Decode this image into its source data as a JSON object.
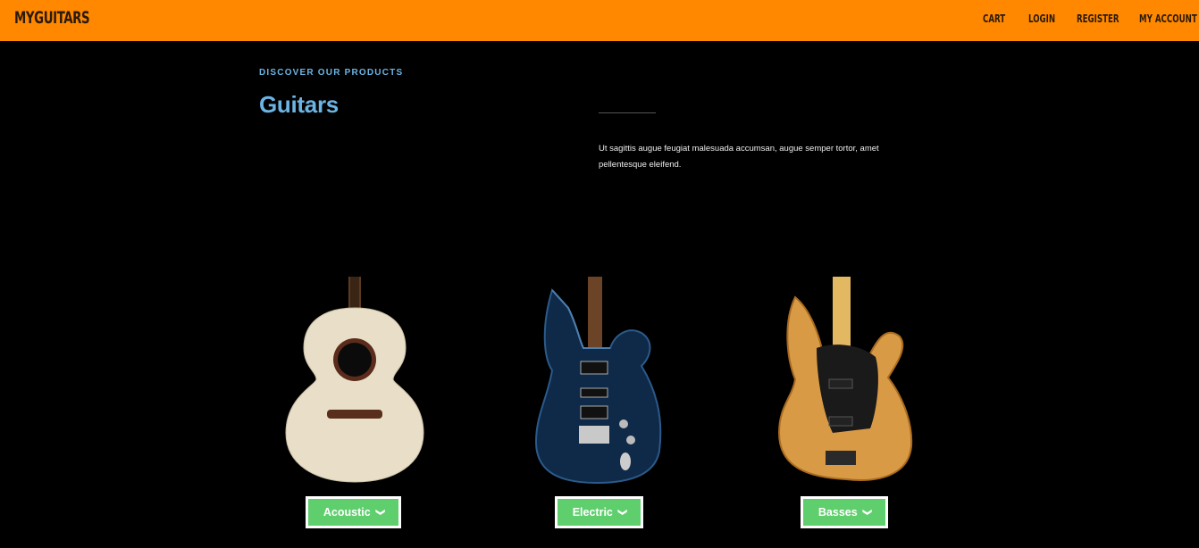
{
  "header": {
    "brand": "MYGUITARS",
    "nav": [
      "CART",
      "LOGIN",
      "REGISTER",
      "MY ACCOUNT"
    ]
  },
  "hero": {
    "eyebrow": "DISCOVER OUR PRODUCTS",
    "title": "Guitars",
    "description": "Ut sagittis augue feugiat malesuada accumsan, augue semper tortor, amet pellentesque eleifend."
  },
  "categories": [
    {
      "label": "Acoustic",
      "icon": "chevron-down-icon"
    },
    {
      "label": "Electric",
      "icon": "chevron-down-icon"
    },
    {
      "label": "Basses",
      "icon": "chevron-down-icon"
    }
  ],
  "colors": {
    "header_bg": "#ff8800",
    "accent_blue": "#6cb4e4",
    "button_green": "#5fcf6d",
    "page_bg": "#000000"
  }
}
